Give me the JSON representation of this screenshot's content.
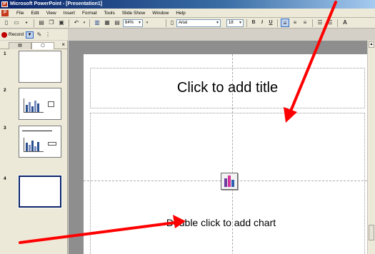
{
  "window": {
    "title": "Microsoft PowerPoint - [Presentation1]",
    "icon": "powerpoint-icon"
  },
  "menu": {
    "items": [
      "File",
      "Edit",
      "View",
      "Insert",
      "Format",
      "Tools",
      "Slide Show",
      "Window",
      "Help"
    ]
  },
  "toolbar": {
    "zoom": "64%",
    "font": "Arial",
    "font_size": "18"
  },
  "recording": {
    "record_label": "Record"
  },
  "slides_panel": {
    "slide_numbers": [
      "1",
      "2",
      "3",
      "4"
    ],
    "selected": 4
  },
  "slide": {
    "title_placeholder": "Click to add title",
    "chart_placeholder": "Double click to add chart"
  },
  "annotations": {
    "color": "#ff0000",
    "arrows": 2
  },
  "colors": {
    "workspace": "#8e8e8e",
    "titlebar": "#0a246a",
    "arrow": "#ff0000"
  }
}
